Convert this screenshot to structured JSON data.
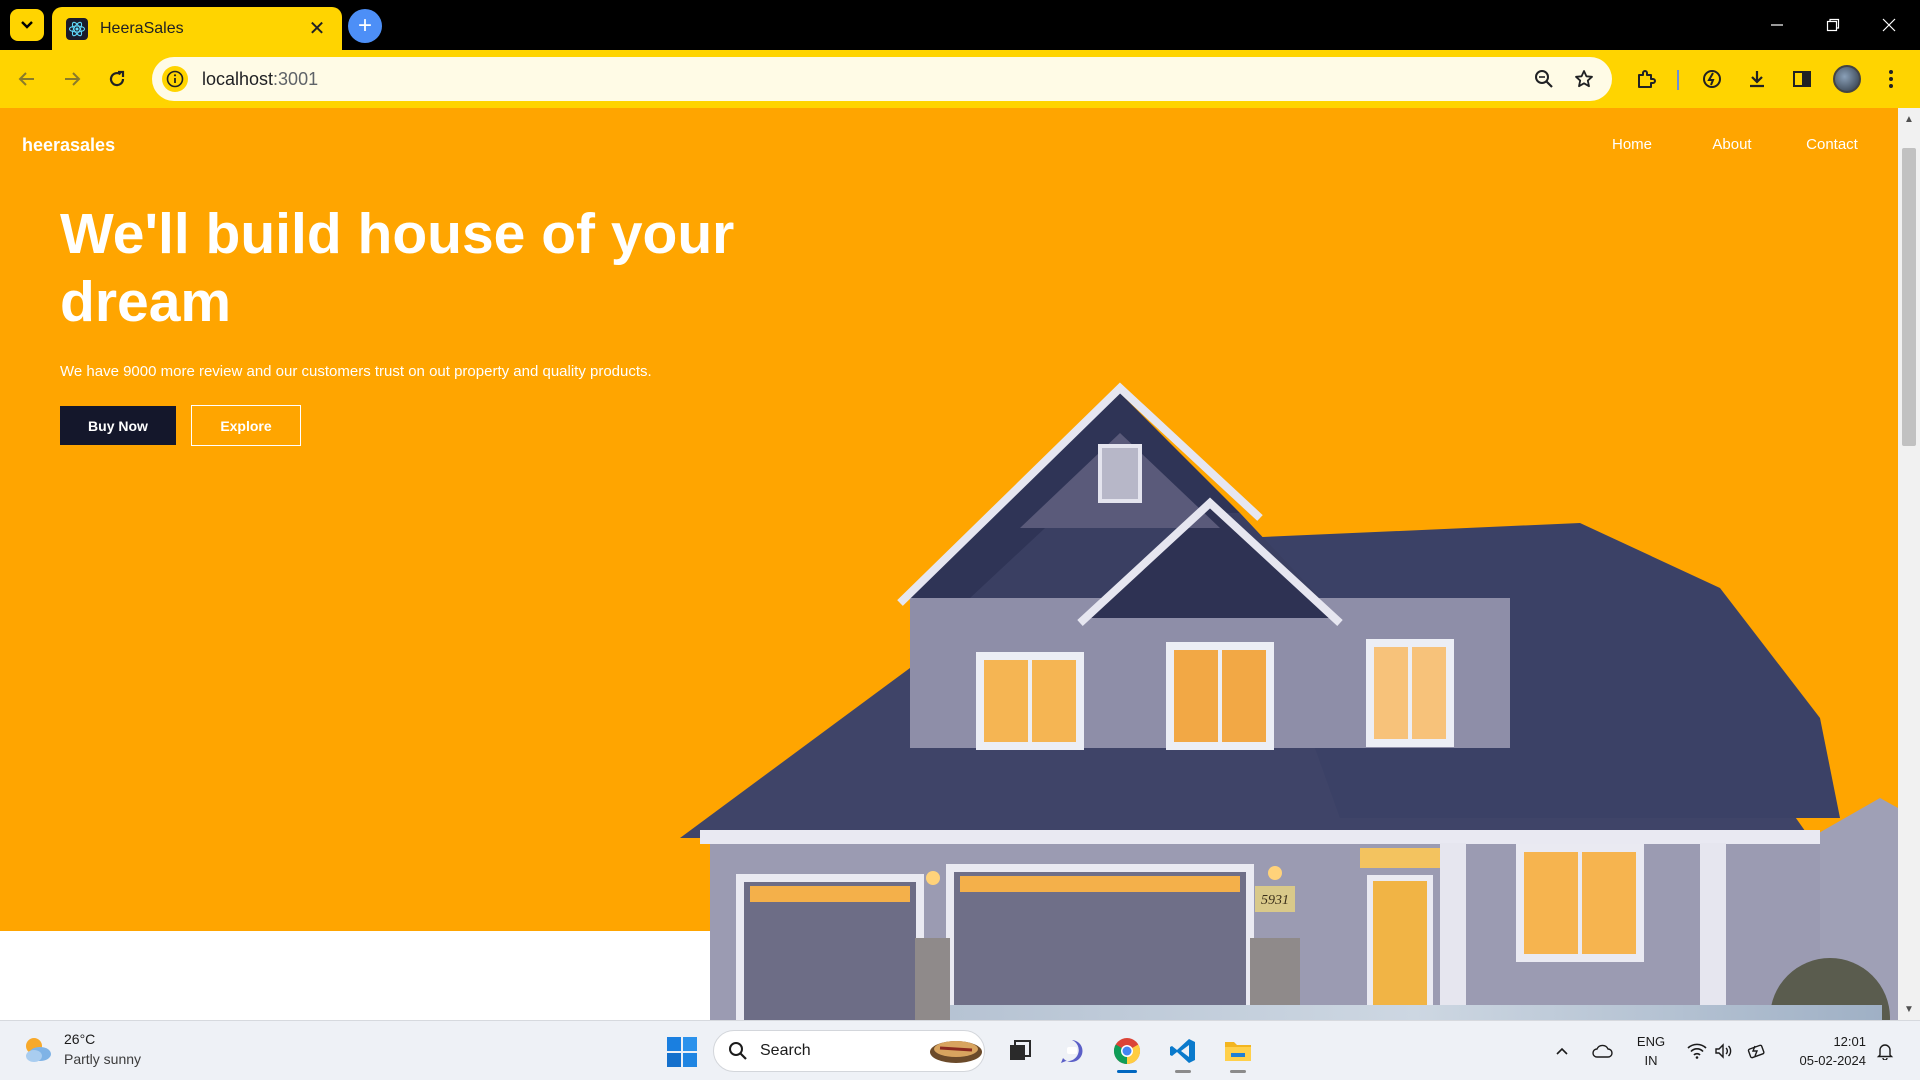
{
  "browser": {
    "tab_title": "HeeraSales",
    "tab_close": "✕",
    "new_tab": "+",
    "url_host": "localhost",
    "url_port": ":3001",
    "accent_color": "#ffd400"
  },
  "site": {
    "brand": "heerasales",
    "nav": [
      "Home",
      "About",
      "Contact"
    ],
    "hero_title": "We'll build house of your dream",
    "hero_subtitle": "We have 9000 more review and our customers trust on out property and quality products.",
    "buy_button": "Buy Now",
    "explore_button": "Explore",
    "hero_color": "#ffa500",
    "dark_button_color": "#14172b",
    "house_number": "5931"
  },
  "taskbar": {
    "temperature": "26°C",
    "condition": "Partly sunny",
    "search_label": "Search",
    "lang_line1": "ENG",
    "lang_line2": "IN",
    "time": "12:01",
    "date": "05-02-2024"
  }
}
